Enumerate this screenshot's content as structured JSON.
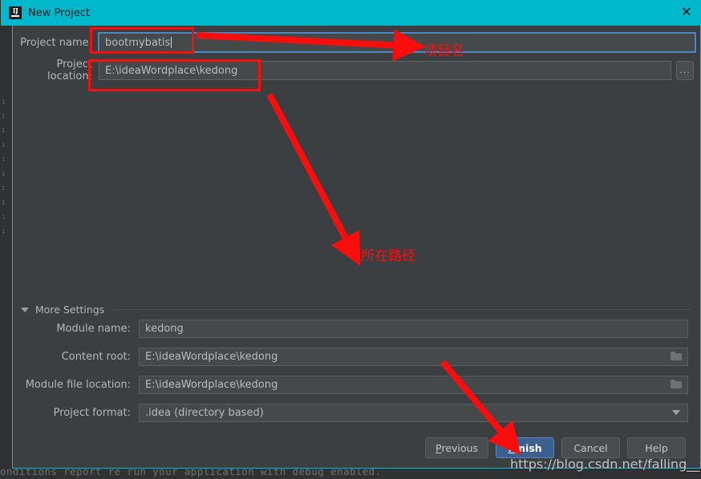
{
  "window": {
    "title": "New Project",
    "app_icon": "intellij-idea-icon",
    "close_label": "✕",
    "titlebar_color": "#00b8cc",
    "background_color": "#3c3f41"
  },
  "top_form": {
    "project_name": {
      "label": "Project name:",
      "value": "bootmybatis",
      "focused": true
    },
    "project_location": {
      "label": "Project location:",
      "value": "E:\\ideaWordplace\\kedong",
      "browse_label": "..."
    }
  },
  "more_settings": {
    "label": "More Settings",
    "expanded": true,
    "fields": [
      {
        "label": "Module name:",
        "value": "kedong",
        "trailing": "none"
      },
      {
        "label": "Content root:",
        "value": "E:\\ideaWordplace\\kedong",
        "trailing": "folder-icon"
      },
      {
        "label": "Module file location:",
        "value": "E:\\ideaWordplace\\kedong",
        "trailing": "folder-icon"
      },
      {
        "label": "Project format:",
        "value": ".idea (directory based)",
        "trailing": "chevron-down-icon"
      }
    ]
  },
  "footer": {
    "previous": {
      "mnemonic": "P",
      "rest": "revious"
    },
    "finish": {
      "mnemonic": "F",
      "rest": "inish",
      "primary": true
    },
    "cancel": "Cancel",
    "help": "Help"
  },
  "annotations": {
    "accent_color": "#fa0d0d",
    "project_name_note": "项目名",
    "project_path_note": "所在路径"
  },
  "watermark": {
    "text": "https://blog.csdn.net/falling__star"
  },
  "background": {
    "console_text": "onditions report re run your application with  debug  enabled.",
    "gutter": [
      "·",
      "·",
      "·",
      "·",
      "·",
      "·",
      "·",
      "·",
      "·",
      "·"
    ]
  }
}
